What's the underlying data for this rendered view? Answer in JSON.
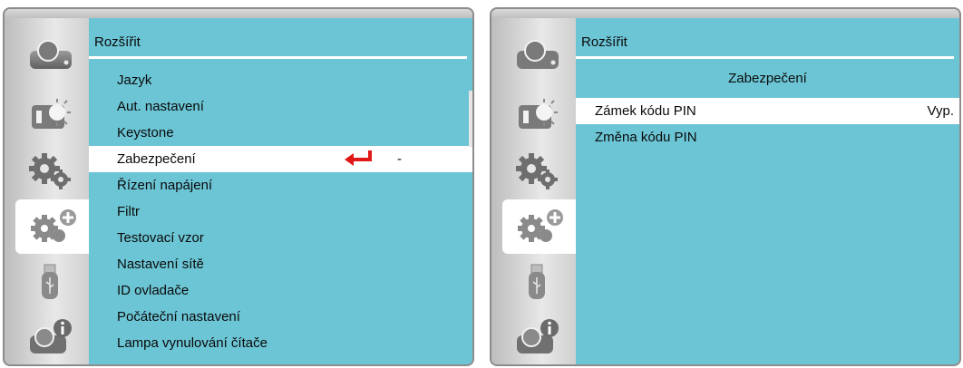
{
  "left_panel": {
    "title": "Rozšířit",
    "items": [
      {
        "label": "Jazyk"
      },
      {
        "label": "Aut. nastavení"
      },
      {
        "label": "Keystone"
      },
      {
        "label": "Zabezpečení",
        "value": "-"
      },
      {
        "label": "Řízení napájení"
      },
      {
        "label": "Filtr"
      },
      {
        "label": "Testovací vzor"
      },
      {
        "label": "Nastavení sítě"
      },
      {
        "label": "ID ovladače"
      },
      {
        "label": "Počáteční nastavení"
      },
      {
        "label": "Lampa vynulování čítače"
      }
    ],
    "selected_index": 3
  },
  "right_panel": {
    "title": "Rozšířit",
    "subtitle": "Zabezpečení",
    "items": [
      {
        "label": "Zámek kódu PIN",
        "value": "Vyp."
      },
      {
        "label": "Změna kódu PIN"
      }
    ],
    "selected_index": 0
  },
  "sidebar": {
    "icons": [
      "projector-icon",
      "picture-brightness-icon",
      "settings-gears-icon",
      "advanced-settings-icon",
      "usb-icon",
      "info-icon"
    ],
    "active_index": 3
  },
  "colors": {
    "panel_background": "#6cc5d5",
    "selected_row": "#ffffff",
    "enter_arrow": "#e01818"
  }
}
